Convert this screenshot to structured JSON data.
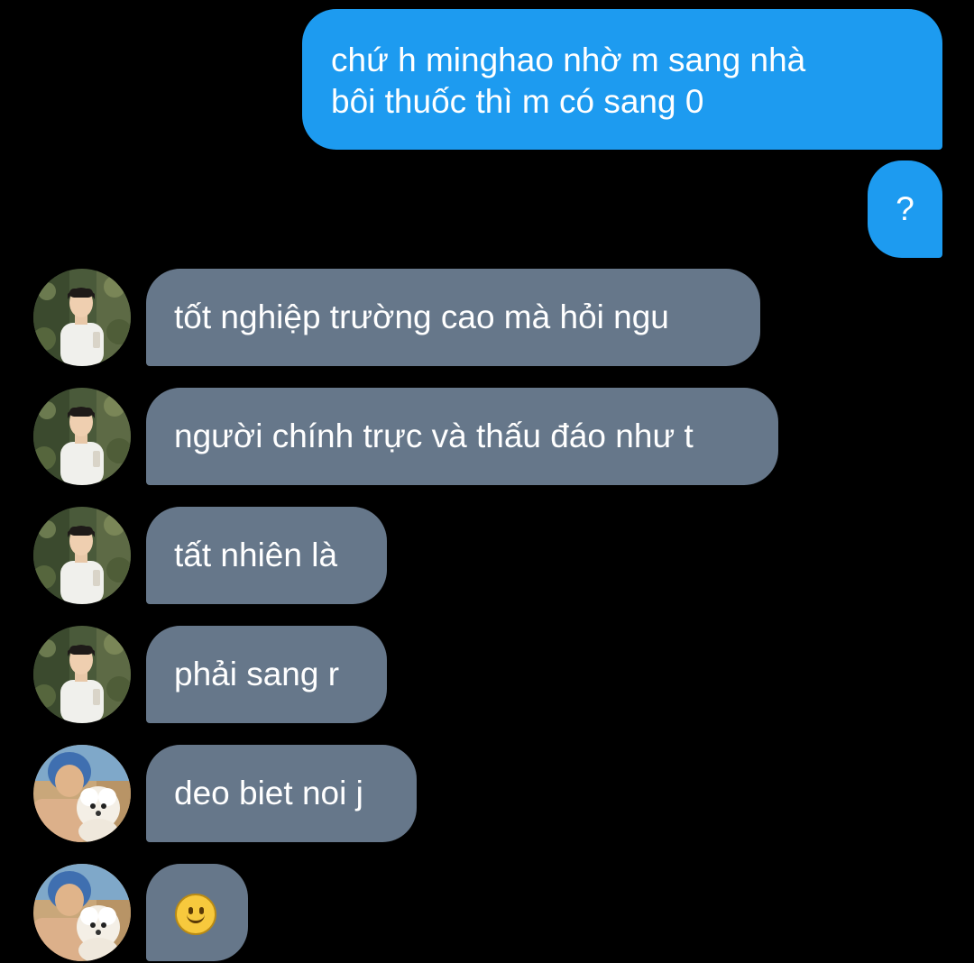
{
  "conversation": {
    "messages": [
      {
        "direction": "outgoing",
        "lines": [
          "chứ h minghao nhờ m sang nhà",
          "bôi thuốc thì m có sang 0"
        ]
      },
      {
        "direction": "outgoing",
        "text": "?"
      },
      {
        "direction": "incoming",
        "sender_avatar": "avatar-person-white-shirt",
        "text": "tốt nghiệp trường cao mà hỏi ngu"
      },
      {
        "direction": "incoming",
        "sender_avatar": "avatar-person-white-shirt",
        "text": "người chính trực và thấu đáo như t"
      },
      {
        "direction": "incoming",
        "sender_avatar": "avatar-person-white-shirt",
        "text": "tất nhiên là"
      },
      {
        "direction": "incoming",
        "sender_avatar": "avatar-person-white-shirt",
        "text": "phải sang r"
      },
      {
        "direction": "incoming",
        "sender_avatar": "avatar-person-with-dog",
        "text": "deo biet noi j"
      },
      {
        "direction": "incoming",
        "sender_avatar": "avatar-person-with-dog",
        "emoji": "slightly-smiling-face"
      }
    ]
  },
  "colors": {
    "background": "#000000",
    "outgoing_bubble": "#1d9bf0",
    "incoming_bubble": "#66778a",
    "text": "#ffffff"
  }
}
